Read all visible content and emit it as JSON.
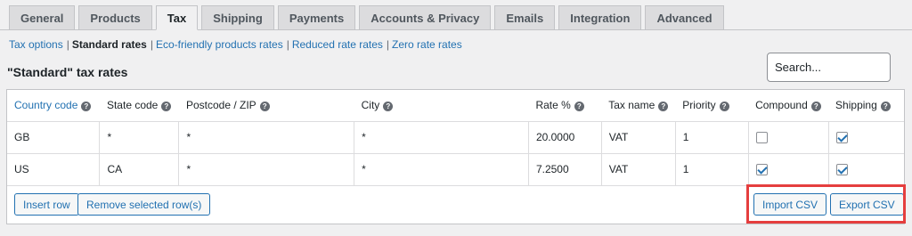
{
  "tabs": [
    {
      "label": "General"
    },
    {
      "label": "Products"
    },
    {
      "label": "Tax"
    },
    {
      "label": "Shipping"
    },
    {
      "label": "Payments"
    },
    {
      "label": "Accounts & Privacy"
    },
    {
      "label": "Emails"
    },
    {
      "label": "Integration"
    },
    {
      "label": "Advanced"
    }
  ],
  "subnav": {
    "tax_options": "Tax options",
    "standard_rates": "Standard rates",
    "eco_rates": "Eco-friendly products rates",
    "reduced_rates": "Reduced rate rates",
    "zero_rates": "Zero rate rates",
    "separator": "|"
  },
  "heading": "\"Standard\" tax rates",
  "search": {
    "placeholder": "Search..."
  },
  "columns": [
    "Country code",
    "State code",
    "Postcode / ZIP",
    "City",
    "Rate %",
    "Tax name",
    "Priority",
    "Compound",
    "Shipping"
  ],
  "rows": [
    {
      "country": "GB",
      "state": "*",
      "postcode": "*",
      "city": "*",
      "rate": "20.0000",
      "tax_name": "VAT",
      "priority": "1",
      "compound": false,
      "shipping": true
    },
    {
      "country": "US",
      "state": "CA",
      "postcode": "*",
      "city": "*",
      "rate": "7.2500",
      "tax_name": "VAT",
      "priority": "1",
      "compound": true,
      "shipping": true
    }
  ],
  "buttons": {
    "insert_row": "Insert row",
    "remove_rows": "Remove selected row(s)",
    "import_csv": "Import CSV",
    "export_csv": "Export CSV"
  },
  "colors": {
    "accent": "#2271b1",
    "highlight": "#e53e3e"
  }
}
